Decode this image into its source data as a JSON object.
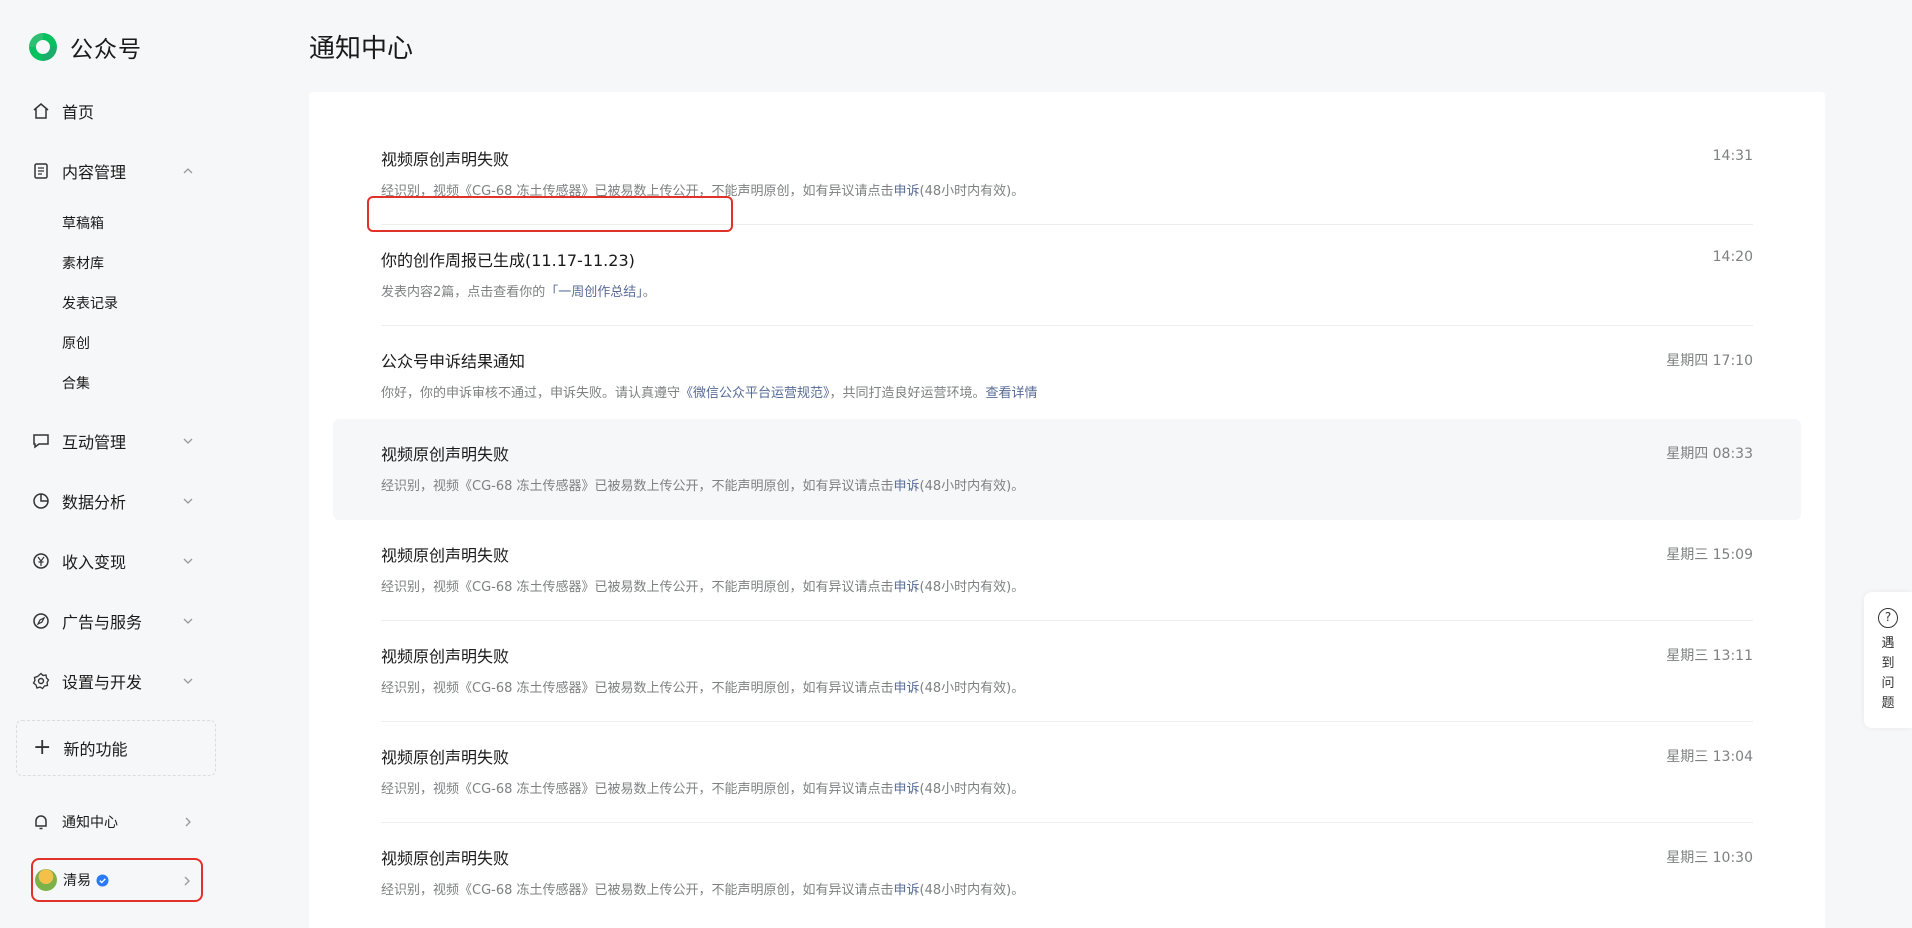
{
  "app": {
    "name": "公众号"
  },
  "sidebar": {
    "home": "首页",
    "content_mgmt": "内容管理",
    "content_sub": [
      "草稿箱",
      "素材库",
      "发表记录",
      "原创",
      "合集"
    ],
    "interaction": "互动管理",
    "analytics": "数据分析",
    "monetization": "收入变现",
    "ads": "广告与服务",
    "settings": "设置与开发",
    "new_features": "新的功能",
    "notifications": "通知中心",
    "account_name": "清易"
  },
  "page": {
    "title": "通知中心"
  },
  "notices": [
    {
      "title": "视频原创声明失败",
      "time": "14:31",
      "desc_pre": "经识别，视频《CG-68 冻土传感器》已被易数上传公开，不能声明原创，如有异议请点击",
      "link": "申诉",
      "desc_post": "(48小时内有效)。"
    },
    {
      "title": "你的创作周报已生成(11.17-11.23)",
      "time": "14:20",
      "desc_pre": "发表内容2篇，点击查看你的",
      "link": "「一周创作总结」",
      "desc_post": "。"
    },
    {
      "title": "公众号申诉结果通知",
      "time": "星期四 17:10",
      "desc_pre": "你好，你的申诉审核不通过，申诉失败。请认真遵守",
      "link": "《微信公众平台运营规范》",
      "desc_post": "，共同打造良好运营环境。",
      "link2": "查看详情"
    },
    {
      "title": "视频原创声明失败",
      "time": "星期四 08:33",
      "desc_pre": "经识别，视频《CG-68 冻土传感器》已被易数上传公开，不能声明原创，如有异议请点击",
      "link": "申诉",
      "desc_post": "(48小时内有效)。"
    },
    {
      "title": "视频原创声明失败",
      "time": "星期三 15:09",
      "desc_pre": "经识别，视频《CG-68 冻土传感器》已被易数上传公开，不能声明原创，如有异议请点击",
      "link": "申诉",
      "desc_post": "(48小时内有效)。"
    },
    {
      "title": "视频原创声明失败",
      "time": "星期三 13:11",
      "desc_pre": "经识别，视频《CG-68 冻土传感器》已被易数上传公开，不能声明原创，如有异议请点击",
      "link": "申诉",
      "desc_post": "(48小时内有效)。"
    },
    {
      "title": "视频原创声明失败",
      "time": "星期三 13:04",
      "desc_pre": "经识别，视频《CG-68 冻土传感器》已被易数上传公开，不能声明原创，如有异议请点击",
      "link": "申诉",
      "desc_post": "(48小时内有效)。"
    },
    {
      "title": "视频原创声明失败",
      "time": "星期三 10:30",
      "desc_pre": "经识别，视频《CG-68 冻土传感器》已被易数上传公开，不能声明原创，如有异议请点击",
      "link": "申诉",
      "desc_post": "(48小时内有效)。"
    }
  ],
  "help": {
    "label": "遇到问题"
  },
  "colors": {
    "link": "#576b95",
    "brand": "#07c160",
    "highlight": "#e0322b"
  }
}
